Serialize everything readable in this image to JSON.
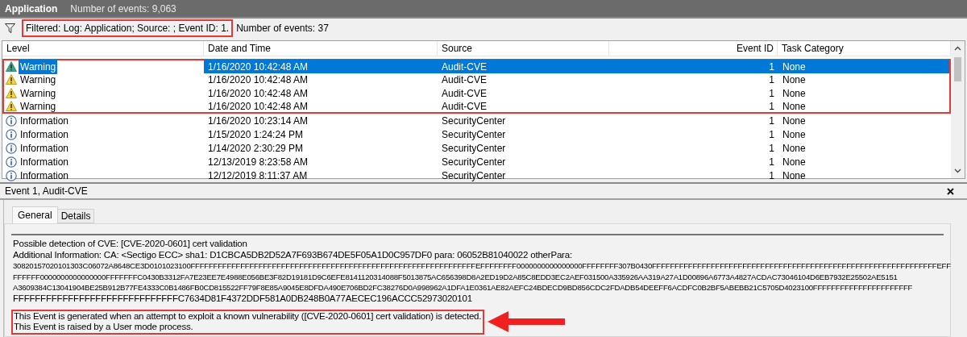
{
  "title_bar": {
    "title": "Application",
    "count": "Number of events: 9,063"
  },
  "filter_bar": {
    "filter": "Filtered: Log: Application; Source: ; Event ID: 1.",
    "highlighted": true,
    "count": "Number of events: 37"
  },
  "table": {
    "columns": [
      "Level",
      "Date and Time",
      "Source",
      "Event ID",
      "Task Category"
    ],
    "rows": [
      {
        "kind": "warning",
        "level": "Warning",
        "date": "1/16/2020 10:42:48 AM",
        "source": "Audit-CVE",
        "event_id": "1",
        "category": "None",
        "selected": true,
        "highlighted": true
      },
      {
        "kind": "warning",
        "level": "Warning",
        "date": "1/16/2020 10:42:48 AM",
        "source": "Audit-CVE",
        "event_id": "1",
        "category": "None",
        "selected": false,
        "highlighted": true
      },
      {
        "kind": "warning",
        "level": "Warning",
        "date": "1/16/2020 10:42:48 AM",
        "source": "Audit-CVE",
        "event_id": "1",
        "category": "None",
        "selected": false,
        "highlighted": true
      },
      {
        "kind": "warning",
        "level": "Warning",
        "date": "1/16/2020 10:42:48 AM",
        "source": "Audit-CVE",
        "event_id": "1",
        "category": "None",
        "selected": false,
        "highlighted": true
      },
      {
        "kind": "information",
        "level": "Information",
        "date": "1/16/2020 10:23:14 AM",
        "source": "SecurityCenter",
        "event_id": "1",
        "category": "None",
        "selected": false,
        "highlighted": false
      },
      {
        "kind": "information",
        "level": "Information",
        "date": "1/15/2020 1:24:24 PM",
        "source": "SecurityCenter",
        "event_id": "1",
        "category": "None",
        "selected": false,
        "highlighted": false
      },
      {
        "kind": "information",
        "level": "Information",
        "date": "1/14/2020 2:30:29 PM",
        "source": "SecurityCenter",
        "event_id": "1",
        "category": "None",
        "selected": false,
        "highlighted": false
      },
      {
        "kind": "information",
        "level": "Information",
        "date": "12/13/2019 8:23:58 AM",
        "source": "SecurityCenter",
        "event_id": "1",
        "category": "None",
        "selected": false,
        "highlighted": false
      },
      {
        "kind": "information",
        "level": "Information",
        "date": "12/12/2019 8:11:37 AM",
        "source": "SecurityCenter",
        "event_id": "1",
        "category": "None",
        "selected": false,
        "highlighted": false
      }
    ]
  },
  "detail": {
    "title": "Event 1, Audit-CVE",
    "tabs": [
      {
        "label": "General",
        "selected": true
      },
      {
        "label": "Details",
        "selected": false
      }
    ],
    "lines": [
      "Possible detection of CVE: [CVE-2020-0601] cert validation",
      "Additional Information: CA: <Sectigo ECC> sha1: D1CBCA5DB2D52A7F693B674DE5F05A1D0C957DF0 para: 06052B81040022 otherPara:",
      "30820157020101303C06072A8648CE3D0101023100FFFFFFFFFFFFFFFFFFFFFFFFFFFFFFFFFFFFFFFFFFFFFFFFFFFFFFFFFFFFFFFEFFFFFFFF0000000000000000FFFFFFFF307B0430FFFFFFFFFFFFFFFFFFFFFFFFFFFFFFFFFFFFFFFFFFFFFFFFFFFFFFFFFFFFFFFEFF",
      "FFFFFF0000000000000000FFFFFFFC0430B3312FA7E23EE7E4988E056BE3F82D19181D9C6EFE8141120314088F5013875AC656398D8A2ED19D2A85C8EDD3EC2AEF031500A335926AA319A27A1D00896A6773A4827ACDAC73046104D6EB7932E25502AE5151",
      "A3609384C13041904BE25B912B77FE4333C0B1486FB0CD815522FF79F8E85A9045E8DFDA490E706BD2FC38276D0A998962A1DFA1E0361AE82AEFC24BDECD9BD856CDC2FDADB54DEEFF6ACDFC0B2BF5ABEBB21C5705D4023100FFFFFFFFFFFFFFFFFFFFFF",
      "FFFFFFFFFFFFFFFFFFFFFFFFFFFFFFC7634D81F4372DDF581A0DB248B0A77AECEC196ACCC52973020101"
    ],
    "notes": [
      "This Event is generated when an attempt to exploit a known vulnerability ([CVE-2020-0601] cert validation) is detected.",
      "This Event is raised by a User mode process."
    ],
    "notes_highlighted": true,
    "callout_arrow": true
  }
}
